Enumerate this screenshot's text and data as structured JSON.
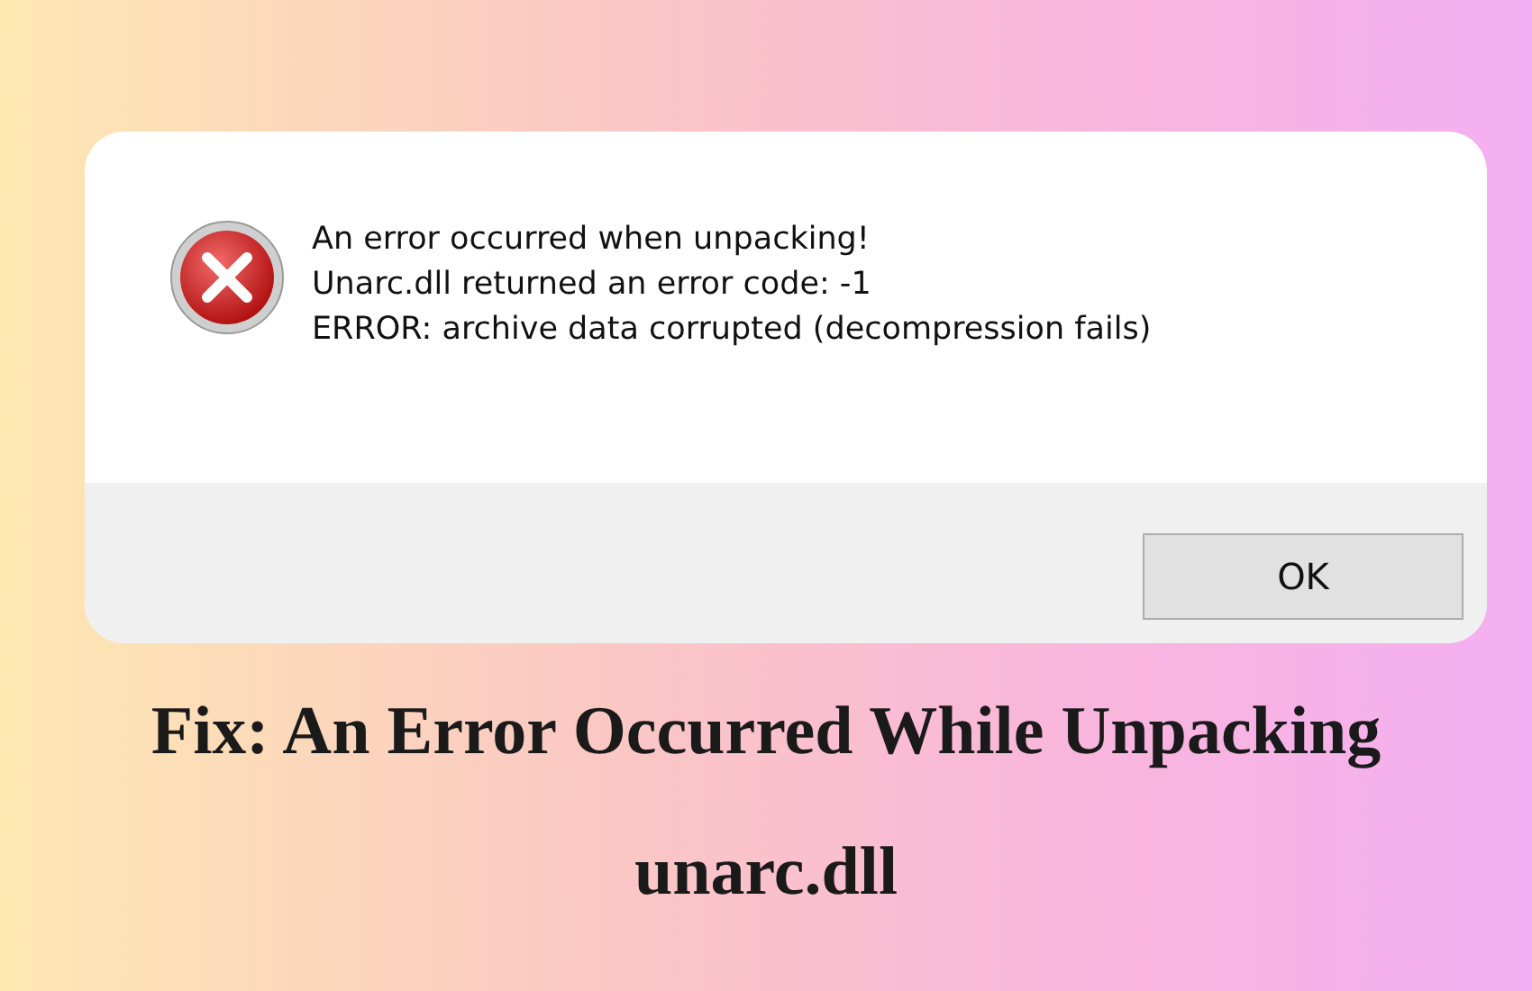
{
  "dialog": {
    "message_lines": [
      "An error occurred when unpacking!",
      "Unarc.dll returned an error code: -1",
      "ERROR: archive data corrupted (decompression fails)"
    ],
    "buttons": [
      {
        "label": "OK"
      }
    ]
  },
  "headline": {
    "lines": [
      "Fix: An Error Occurred While Unpacking",
      "unarc.dll"
    ]
  }
}
